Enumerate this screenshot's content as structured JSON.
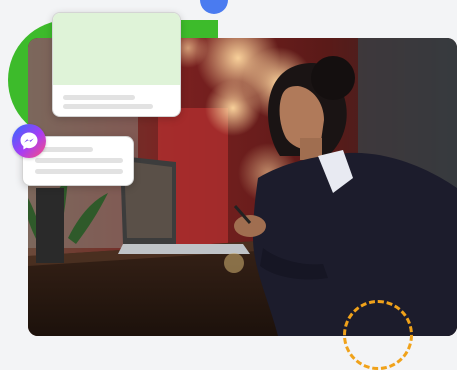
{
  "decor": {
    "green_accent": "#3dbb2b",
    "blue_accent": "#4a7bf0",
    "orange_accent": "#f0a21a",
    "preview_green": "#dff3d8"
  },
  "icons": {
    "messenger": "messenger-icon"
  },
  "photo": {
    "subject": "businesswoman-at-laptop"
  }
}
